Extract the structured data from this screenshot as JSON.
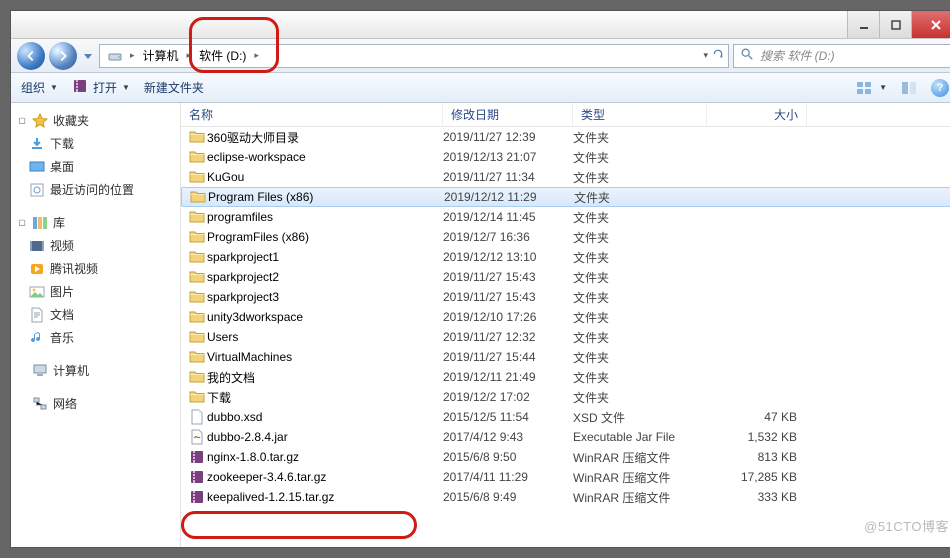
{
  "window": {
    "min": "",
    "max": "",
    "close": ""
  },
  "breadcrumb": {
    "computer": "计算机",
    "drive": "软件 (D:)"
  },
  "search": {
    "placeholder": "搜索 软件 (D:)"
  },
  "toolbar": {
    "organize": "组织",
    "open": "打开",
    "newfolder": "新建文件夹"
  },
  "sidebar": {
    "fav": {
      "label": "收藏夹",
      "items": [
        "下载",
        "桌面",
        "最近访问的位置"
      ]
    },
    "lib": {
      "label": "库",
      "items": [
        "视频",
        "腾讯视频",
        "图片",
        "文档",
        "音乐"
      ]
    },
    "computer": "计算机",
    "network": "网络"
  },
  "columns": {
    "name": "名称",
    "date": "修改日期",
    "type": "类型",
    "size": "大小"
  },
  "type_folder": "文件夹",
  "rows": [
    {
      "k": "folder",
      "n": "360驱动大师目录",
      "d": "2019/11/27 12:39",
      "t": "文件夹",
      "s": ""
    },
    {
      "k": "folder",
      "n": "eclipse-workspace",
      "d": "2019/12/13 21:07",
      "t": "文件夹",
      "s": ""
    },
    {
      "k": "folder",
      "n": "KuGou",
      "d": "2019/11/27 11:34",
      "t": "文件夹",
      "s": ""
    },
    {
      "k": "folder",
      "n": "Program Files (x86)",
      "d": "2019/12/12 11:29",
      "t": "文件夹",
      "s": "",
      "sel": true
    },
    {
      "k": "folder",
      "n": "programfiles",
      "d": "2019/12/14 11:45",
      "t": "文件夹",
      "s": ""
    },
    {
      "k": "folder",
      "n": "ProgramFiles (x86)",
      "d": "2019/12/7 16:36",
      "t": "文件夹",
      "s": ""
    },
    {
      "k": "folder",
      "n": "sparkproject1",
      "d": "2019/12/12 13:10",
      "t": "文件夹",
      "s": ""
    },
    {
      "k": "folder",
      "n": "sparkproject2",
      "d": "2019/11/27 15:43",
      "t": "文件夹",
      "s": ""
    },
    {
      "k": "folder",
      "n": "sparkproject3",
      "d": "2019/11/27 15:43",
      "t": "文件夹",
      "s": ""
    },
    {
      "k": "folder",
      "n": "unity3dworkspace",
      "d": "2019/12/10 17:26",
      "t": "文件夹",
      "s": ""
    },
    {
      "k": "folder",
      "n": "Users",
      "d": "2019/11/27 12:32",
      "t": "文件夹",
      "s": ""
    },
    {
      "k": "folder",
      "n": "VirtualMachines",
      "d": "2019/11/27 15:44",
      "t": "文件夹",
      "s": ""
    },
    {
      "k": "folder",
      "n": "我的文档",
      "d": "2019/12/11 21:49",
      "t": "文件夹",
      "s": ""
    },
    {
      "k": "folder",
      "n": "下载",
      "d": "2019/12/2 17:02",
      "t": "文件夹",
      "s": ""
    },
    {
      "k": "file",
      "n": "dubbo.xsd",
      "d": "2015/12/5 11:54",
      "t": "XSD 文件",
      "s": "47 KB"
    },
    {
      "k": "jar",
      "n": "dubbo-2.8.4.jar",
      "d": "2017/4/12 9:43",
      "t": "Executable Jar File",
      "s": "1,532 KB"
    },
    {
      "k": "rar",
      "n": "nginx-1.8.0.tar.gz",
      "d": "2015/6/8 9:50",
      "t": "WinRAR 压缩文件",
      "s": "813 KB"
    },
    {
      "k": "rar",
      "n": "zookeeper-3.4.6.tar.gz",
      "d": "2017/4/11 11:29",
      "t": "WinRAR 压缩文件",
      "s": "17,285 KB"
    },
    {
      "k": "rar",
      "n": "keepalived-1.2.15.tar.gz",
      "d": "2015/6/8 9:49",
      "t": "WinRAR 压缩文件",
      "s": "333 KB"
    }
  ],
  "watermark": "@51CTO博客"
}
